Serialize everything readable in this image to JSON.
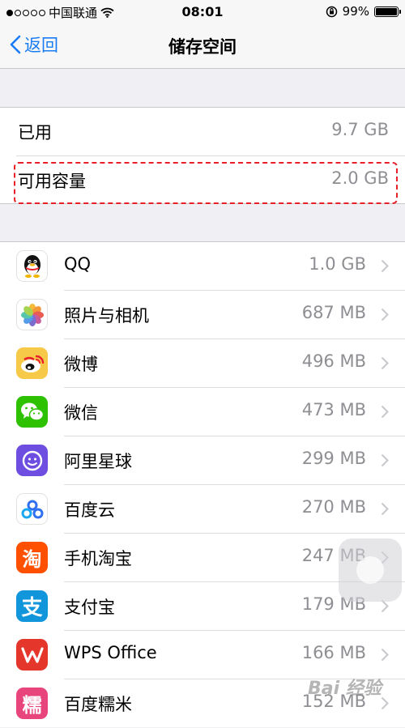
{
  "status_bar": {
    "carrier": "中国联通",
    "time": "08:01",
    "battery": "99%",
    "battery_level": 0.99
  },
  "nav": {
    "back_label": "返回",
    "title": "储存空间"
  },
  "storage": {
    "used_label": "已用",
    "used_value": "9.7 GB",
    "available_label": "可用容量",
    "available_value": "2.0 GB"
  },
  "apps": [
    {
      "name": "QQ",
      "size": "1.0 GB",
      "icon": "qq-icon"
    },
    {
      "name": "照片与相机",
      "size": "687 MB",
      "icon": "photos-icon"
    },
    {
      "name": "微博",
      "size": "496 MB",
      "icon": "weibo-icon"
    },
    {
      "name": "微信",
      "size": "473 MB",
      "icon": "wechat-icon"
    },
    {
      "name": "阿里星球",
      "size": "299 MB",
      "icon": "ali-planet-icon"
    },
    {
      "name": "百度云",
      "size": "270 MB",
      "icon": "baidu-cloud-icon"
    },
    {
      "name": "手机淘宝",
      "size": "247 MB",
      "icon": "taobao-icon"
    },
    {
      "name": "支付宝",
      "size": "179 MB",
      "icon": "alipay-icon"
    },
    {
      "name": "WPS Office",
      "size": "166 MB",
      "icon": "wps-icon"
    },
    {
      "name": "百度糯米",
      "size": "152 MB",
      "icon": "baidu-nuomi-icon"
    }
  ],
  "icon_glyphs": {
    "taobao": "淘",
    "alipay": "支",
    "nuomi": "糯"
  },
  "watermark": "Bai 经验",
  "colors": {
    "accent": "#1a7cf5",
    "highlight": "#e8202a"
  }
}
